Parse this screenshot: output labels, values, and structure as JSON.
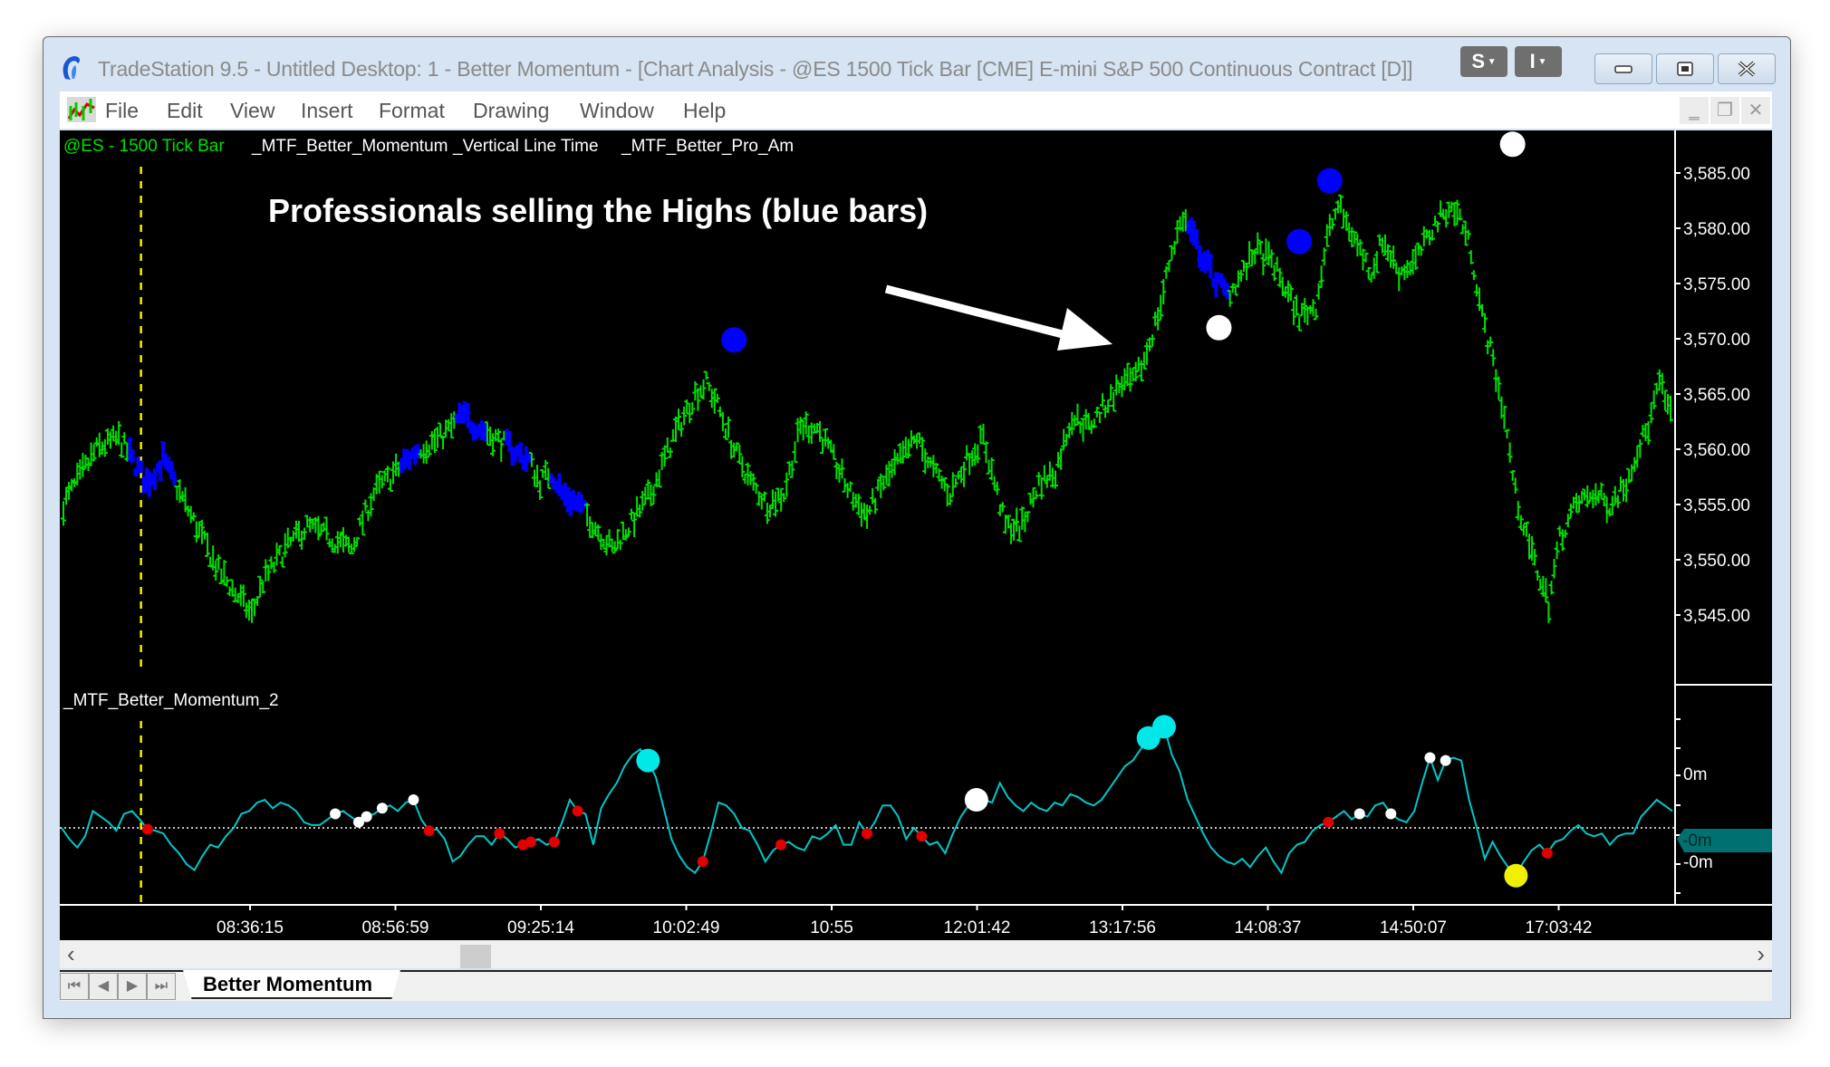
{
  "window": {
    "title": "TradeStation 9.5 - Untitled Desktop: 1 - Better Momentum - [Chart Analysis - @ES 1500 Tick Bar [CME] E-mini S&P 500 Continuous Contract [D",
    "title_suffix": "]]",
    "s_button": "S",
    "i_button": "I"
  },
  "menu": {
    "items": [
      "File",
      "Edit",
      "View",
      "Insert",
      "Format",
      "Drawing",
      "Window",
      "Help"
    ]
  },
  "colors": {
    "bar_up": "#00e000",
    "bar_pro": "#0000ff",
    "osc_line": "#00c8c8",
    "dot_blue": "#0000ff",
    "dot_white": "#ffffff",
    "dot_yellow": "#f0f000",
    "dot_cyan": "#00e8e8",
    "dot_red": "#e00000",
    "vline": "#f0f000",
    "axis_text": "#ffffff",
    "last_value_badge": "#007070"
  },
  "legend": {
    "symbol": "@ES - 1500 Tick Bar",
    "studies": [
      "_MTF_Better_Momentum",
      "_Vertical Line Time",
      "_MTF_Better_Pro_Am"
    ],
    "osc_title": "_MTF_Better_Momentum_2"
  },
  "annotation": {
    "text": "Professionals selling the Highs (blue bars)"
  },
  "tabs": {
    "active": "Better Momentum"
  },
  "chart_data": [
    {
      "type": "bar",
      "subtype": "ohlc-tick-bars",
      "title": "@ES - 1500 Tick Bar",
      "ylabel": "Price",
      "ylim": [
        3541,
        3589
      ],
      "y_ticks": [
        "3,585.00",
        "3,580.00",
        "3,575.00",
        "3,570.00",
        "3,565.00",
        "3,560.00",
        "3,555.00",
        "3,550.00",
        "3,545.00"
      ],
      "y_tick_values": [
        3585,
        3580,
        3575,
        3570,
        3565,
        3560,
        3555,
        3550,
        3545
      ],
      "x_tick_labels": [
        "08:36:15",
        "08:56:59",
        "09:25:14",
        "10:02:49",
        "10:55",
        "12:01:42",
        "13:17:56",
        "14:08:37",
        "14:50:07",
        "17:03:42"
      ],
      "bar_count": 470,
      "price_path": [
        [
          0,
          3555
        ],
        [
          12,
          3560
        ],
        [
          20,
          3561
        ],
        [
          30,
          3557
        ],
        [
          36,
          3559
        ],
        [
          42,
          3556
        ],
        [
          50,
          3552
        ],
        [
          56,
          3549
        ],
        [
          62,
          3547
        ],
        [
          68,
          3545
        ],
        [
          72,
          3548
        ],
        [
          80,
          3551
        ],
        [
          88,
          3553
        ],
        [
          96,
          3552
        ],
        [
          104,
          3551
        ],
        [
          112,
          3556
        ],
        [
          120,
          3558
        ],
        [
          128,
          3560
        ],
        [
          136,
          3561
        ],
        [
          144,
          3563
        ],
        [
          150,
          3562
        ],
        [
          156,
          3561
        ],
        [
          162,
          3560
        ],
        [
          168,
          3559
        ],
        [
          172,
          3557
        ],
        [
          176,
          3558
        ],
        [
          180,
          3556
        ],
        [
          186,
          3555
        ],
        [
          192,
          3553
        ],
        [
          198,
          3551
        ],
        [
          204,
          3553
        ],
        [
          212,
          3556
        ],
        [
          220,
          3561
        ],
        [
          228,
          3565
        ],
        [
          232,
          3566
        ],
        [
          236,
          3564
        ],
        [
          242,
          3560
        ],
        [
          248,
          3557
        ],
        [
          254,
          3555
        ],
        [
          260,
          3556
        ],
        [
          266,
          3562
        ],
        [
          272,
          3562
        ],
        [
          278,
          3559
        ],
        [
          284,
          3556
        ],
        [
          290,
          3554
        ],
        [
          296,
          3557
        ],
        [
          302,
          3559
        ],
        [
          308,
          3561
        ],
        [
          314,
          3558
        ],
        [
          320,
          3556
        ],
        [
          326,
          3559
        ],
        [
          332,
          3561
        ],
        [
          336,
          3557
        ],
        [
          340,
          3553
        ],
        [
          346,
          3553
        ],
        [
          352,
          3557
        ],
        [
          358,
          3558
        ],
        [
          364,
          3563
        ],
        [
          370,
          3562
        ],
        [
          376,
          3564
        ],
        [
          382,
          3566
        ],
        [
          386,
          3566
        ],
        [
          390,
          3568
        ],
        [
          396,
          3573
        ],
        [
          400,
          3578
        ],
        [
          404,
          3581
        ],
        [
          408,
          3579
        ],
        [
          414,
          3576
        ],
        [
          420,
          3574
        ],
        [
          426,
          3576
        ],
        [
          430,
          3578
        ],
        [
          436,
          3577
        ],
        [
          440,
          3575
        ],
        [
          446,
          3572
        ],
        [
          452,
          3573
        ],
        [
          456,
          3579
        ],
        [
          460,
          3582
        ],
        [
          466,
          3579
        ],
        [
          472,
          3576
        ],
        [
          476,
          3579
        ],
        [
          482,
          3576
        ],
        [
          488,
          3577
        ],
        [
          494,
          3580
        ],
        [
          500,
          3582
        ],
        [
          504,
          3581
        ],
        [
          508,
          3578
        ],
        [
          512,
          3572
        ],
        [
          516,
          3568
        ],
        [
          520,
          3563
        ],
        [
          524,
          3556
        ],
        [
          528,
          3552
        ],
        [
          532,
          3549
        ],
        [
          536,
          3546
        ],
        [
          540,
          3552
        ],
        [
          546,
          3555
        ],
        [
          552,
          3556
        ],
        [
          558,
          3555
        ],
        [
          564,
          3557
        ],
        [
          568,
          3560
        ],
        [
          572,
          3562
        ],
        [
          576,
          3566
        ],
        [
          580,
          3563
        ]
      ],
      "pro_selling_bar_ranges": [
        [
          24,
          40
        ],
        [
          122,
          128
        ],
        [
          142,
          152
        ],
        [
          160,
          168
        ],
        [
          176,
          188
        ],
        [
          406,
          420
        ]
      ],
      "signal_dots": [
        {
          "color": "blue",
          "bar": 242,
          "price": 3569.9
        },
        {
          "color": "white",
          "bar": 417,
          "price": 3571.0
        },
        {
          "color": "blue",
          "bar": 446,
          "price": 3578.8
        },
        {
          "color": "blue",
          "bar": 457,
          "price": 3584.3
        },
        {
          "color": "white",
          "bar": 523,
          "price": 3587.6
        },
        {
          "color": "yellow",
          "bar": 589,
          "price": 3581.0
        }
      ],
      "vertical_lines": [
        {
          "bar": 28
        },
        {
          "bar": 594
        }
      ]
    },
    {
      "type": "line",
      "title": "_MTF_Better_Momentum_2",
      "ylabel": "",
      "y_ticks": [
        "0m",
        "-0m",
        "-0m"
      ],
      "zero_line": "dotted",
      "last_value_label": "-0m",
      "series": [
        {
          "name": "_MTF_Better_Momentum_2",
          "values": [
            0,
            -0.4,
            -0.7,
            -0.3,
            0.6,
            0.4,
            0.2,
            -0.1,
            0.5,
            0.6,
            0.3,
            -0.05,
            -0.1,
            -0.2,
            -0.6,
            -0.9,
            -1.3,
            -1.5,
            -1.0,
            -0.6,
            -0.7,
            -0.3,
            0.0,
            0.5,
            0.6,
            0.9,
            1.0,
            0.7,
            0.9,
            0.8,
            0.6,
            0.2,
            0.1,
            0.1,
            0.3,
            0.5,
            0.6,
            0.4,
            0.2,
            0.4,
            0.5,
            0.7,
            0.8,
            0.6,
            0.9,
            1.0,
            0.3,
            -0.1,
            -0.05,
            -0.4,
            -1.2,
            -1.0,
            -0.6,
            -0.3,
            -0.3,
            -0.6,
            -0.2,
            -0.4,
            -0.7,
            -0.6,
            -0.5,
            -0.4,
            -0.6,
            -0.5,
            0.2,
            1.0,
            0.6,
            0.5,
            -0.6,
            0.7,
            1.2,
            1.6,
            2.2,
            2.6,
            2.8,
            2.4,
            1.8,
            0.7,
            -0.4,
            -1.0,
            -1.4,
            -1.6,
            -1.2,
            -0.2,
            0.9,
            0.8,
            0.5,
            0.0,
            -0.1,
            -0.6,
            -1.2,
            -0.8,
            -0.6,
            -0.5,
            -0.7,
            -0.8,
            -0.3,
            -0.4,
            -0.2,
            0.1,
            -0.6,
            -0.6,
            0.2,
            -0.2,
            0.2,
            0.8,
            0.8,
            0.4,
            -0.4,
            0.0,
            -0.3,
            -0.6,
            -0.5,
            -0.9,
            -0.2,
            0.4,
            0.8,
            1.0,
            1.0,
            0.9,
            1.6,
            1.1,
            0.8,
            0.6,
            0.9,
            0.7,
            0.6,
            0.9,
            0.8,
            1.2,
            1.1,
            0.9,
            0.8,
            1.0,
            1.4,
            1.8,
            2.2,
            2.4,
            2.8,
            3.2,
            3.8,
            3.6,
            2.6,
            2.0,
            1.0,
            0.4,
            -0.2,
            -0.7,
            -1.0,
            -1.2,
            -1.3,
            -1.1,
            -1.4,
            -1.0,
            -0.7,
            -1.2,
            -1.6,
            -0.9,
            -0.6,
            -0.5,
            -0.1,
            0.1,
            0.2,
            0.4,
            0.6,
            0.3,
            0.5,
            0.4,
            0.8,
            0.9,
            0.5,
            0.3,
            0.2,
            0.6,
            1.6,
            2.5,
            1.7,
            2.4,
            2.5,
            2.4,
            1.0,
            0.0,
            -1.1,
            -0.5,
            -1.0,
            -1.4,
            -1.7,
            -1.2,
            -0.8,
            -0.6,
            -0.9,
            -0.5,
            -0.4,
            -0.1,
            0.1,
            -0.2,
            -0.3,
            -0.2,
            -0.6,
            -0.3,
            -0.2,
            -0.2,
            0.4,
            0.7,
            1.0,
            0.8,
            0.6
          ]
        }
      ],
      "markers": [
        {
          "color": "red",
          "index": 11
        },
        {
          "color": "white",
          "index": 35
        },
        {
          "color": "white",
          "index": 38
        },
        {
          "color": "white",
          "index": 39
        },
        {
          "color": "white",
          "index": 41
        },
        {
          "color": "white",
          "index": 45
        },
        {
          "color": "red",
          "index": 47
        },
        {
          "color": "red",
          "index": 56
        },
        {
          "color": "red",
          "index": 59
        },
        {
          "color": "red",
          "index": 60
        },
        {
          "color": "red",
          "index": 63
        },
        {
          "color": "red",
          "index": 66
        },
        {
          "color": "cyan",
          "index": 75
        },
        {
          "color": "red",
          "index": 82
        },
        {
          "color": "red",
          "index": 92
        },
        {
          "color": "red",
          "index": 103
        },
        {
          "color": "red",
          "index": 110
        },
        {
          "color": "white",
          "index": 117
        },
        {
          "color": "cyan",
          "index": 139
        },
        {
          "color": "cyan",
          "index": 141
        },
        {
          "color": "red",
          "index": 162
        },
        {
          "color": "white",
          "index": 166
        },
        {
          "color": "white",
          "index": 170
        },
        {
          "color": "white",
          "index": 175
        },
        {
          "color": "white",
          "index": 177
        },
        {
          "color": "yellow",
          "index": 186
        },
        {
          "color": "red",
          "index": 190
        },
        {
          "color": "red",
          "index": 209
        }
      ]
    }
  ]
}
